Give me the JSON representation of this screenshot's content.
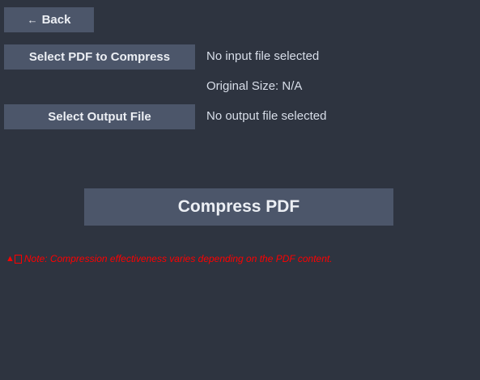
{
  "back_button": {
    "arrow": "←",
    "label": "Back"
  },
  "input": {
    "button_label": "Select PDF to Compress",
    "status": "No input file selected",
    "original_size": "Original Size: N/A"
  },
  "output": {
    "button_label": "Select Output File",
    "status": "No output file selected"
  },
  "compress_button": {
    "label": "Compress PDF"
  },
  "note": {
    "icon": "warning-icon",
    "text": "Note: Compression effectiveness varies depending on the PDF content."
  },
  "colors": {
    "background": "#2e3440",
    "button": "#4c566a",
    "button_text": "#eceff4",
    "label_text": "#d8dee9",
    "note_text": "#ff0000"
  }
}
